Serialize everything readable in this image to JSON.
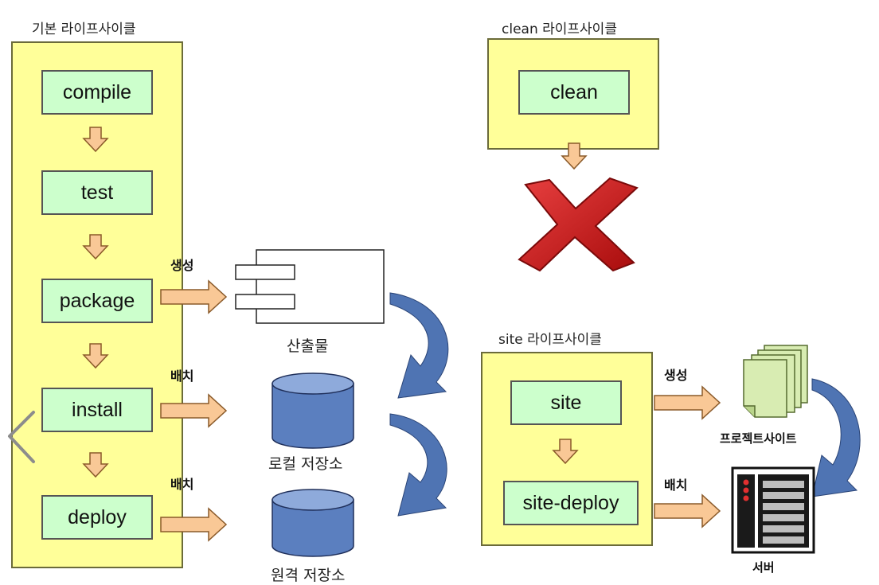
{
  "colors": {
    "lifecycle_fill": "#ffff99",
    "phase_fill": "#ccffcc",
    "arrow_fill": "#f9c896",
    "arrow_stroke": "#8a5a2a",
    "db_fill": "#5b7fbf",
    "db_top": "#8eaadb",
    "curve_arrow": "#4f74b3",
    "x_red": "#cc1a1a"
  },
  "default_lifecycle": {
    "title": "기본 라이프사이클",
    "phases": [
      "compile",
      "test",
      "package",
      "install",
      "deploy"
    ]
  },
  "clean_lifecycle": {
    "title": "clean 라이프사이클",
    "phases": [
      "clean"
    ]
  },
  "site_lifecycle": {
    "title": "site 라이프사이클",
    "phases": [
      "site",
      "site-deploy"
    ]
  },
  "edges": {
    "package_label": "생성",
    "install_label": "배치",
    "deploy_label": "배치",
    "site_label": "생성",
    "site_deploy_label": "배치"
  },
  "targets": {
    "artifact": "산출물",
    "local_repo": "로컬 저장소",
    "remote_repo": "원격 저장소",
    "project_site": "프로젝트사이트",
    "server": "서버"
  },
  "icons": {
    "artifact": "component-icon",
    "repository": "database-icon",
    "site": "document-stack-icon",
    "server": "server-icon",
    "nav_back": "chevron-left-icon",
    "cancel": "x-mark-icon"
  }
}
